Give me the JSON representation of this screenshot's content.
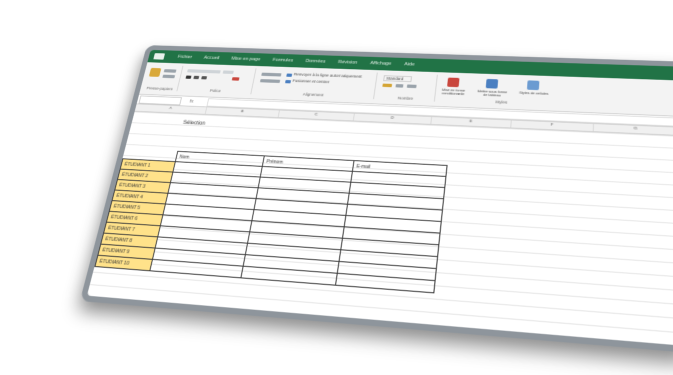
{
  "app": {
    "tabs": [
      "Fichier",
      "Accueil",
      "Mise en page",
      "Formules",
      "Données",
      "Révision",
      "Affichage",
      "Aide"
    ]
  },
  "ribbon": {
    "groups": [
      "Presse-papiers",
      "Police",
      "Alignement",
      "Nombre",
      "Styles"
    ],
    "wrap_text": "Renvoyer à la ligne automatiquement",
    "merge_center": "Fusionner et centrer",
    "number_format": "Standard",
    "conditional_format": "Mise en forme conditionnelle",
    "format_table": "Mettre sous forme de tableau",
    "cell_styles": "Styles de cellules"
  },
  "formulabar": {
    "fx": "fx"
  },
  "columns": [
    "A",
    "B",
    "C",
    "D",
    "E",
    "F",
    "G"
  ],
  "sheet": {
    "title": "Sélection",
    "table_headers": [
      "Nom",
      "Prénom",
      "E-mail"
    ],
    "rows": [
      "ÉTUDIANT 1",
      "ÉTUDIANT 2",
      "ÉTUDIANT 3",
      "ÉTUDIANT 4",
      "ÉTUDIANT 5",
      "ÉTUDIANT 6",
      "ÉTUDIANT 7",
      "ÉTUDIANT 8",
      "ÉTUDIANT 9",
      "ÉTUDIANT 10"
    ]
  },
  "colors": {
    "accent": "#217346",
    "label_fill": "#ffe28a",
    "frame": "#8e959c"
  }
}
